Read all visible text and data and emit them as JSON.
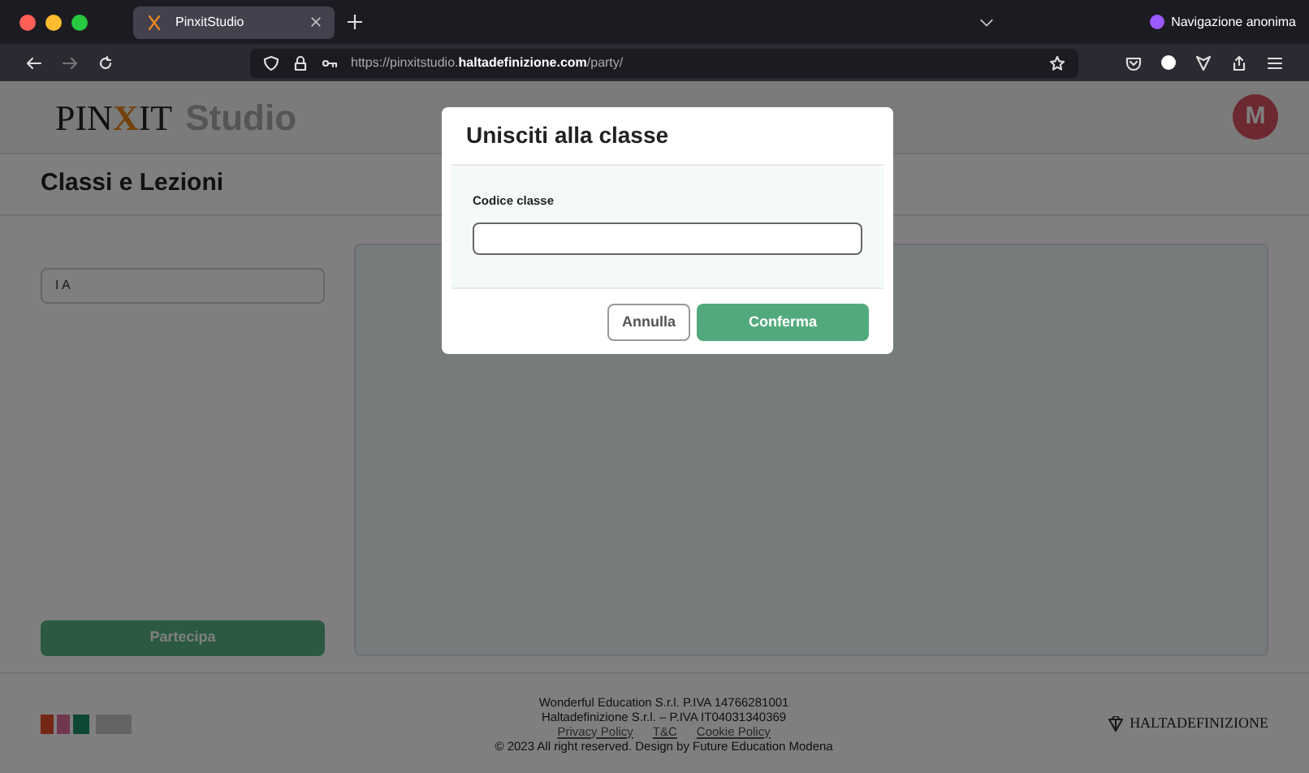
{
  "browser": {
    "tab_title": "PinxitStudio",
    "private_label": "Navigazione anonima",
    "url": {
      "prefix": "https://pinxitstudio.",
      "domain": "haltadefinizione.com",
      "path": "/party/"
    }
  },
  "header": {
    "logo": {
      "prefix": "PIN",
      "mark": "X",
      "suffix": "IT",
      "product": "Studio"
    },
    "avatar": "M"
  },
  "page_title": "Classi e Lezioni",
  "class_field": {
    "value": "I A"
  },
  "join_button": "Partecipa",
  "footer": {
    "lines": [
      "Wonderful Education S.r.l. P.IVA 14766281001",
      "Haltadefinizione S.r.l. – P.IVA IT04031340369"
    ],
    "links": [
      "Privacy Policy",
      "T&C",
      "Cookie Policy"
    ],
    "copyright": "© 2023 All right reserved. Design by Future Education Modena",
    "partner": "HALTADEFINIZIONE"
  },
  "modal": {
    "title": "Unisciti alla classe",
    "field_label": "Codice classe",
    "cancel": "Annulla",
    "confirm": "Conferma"
  }
}
